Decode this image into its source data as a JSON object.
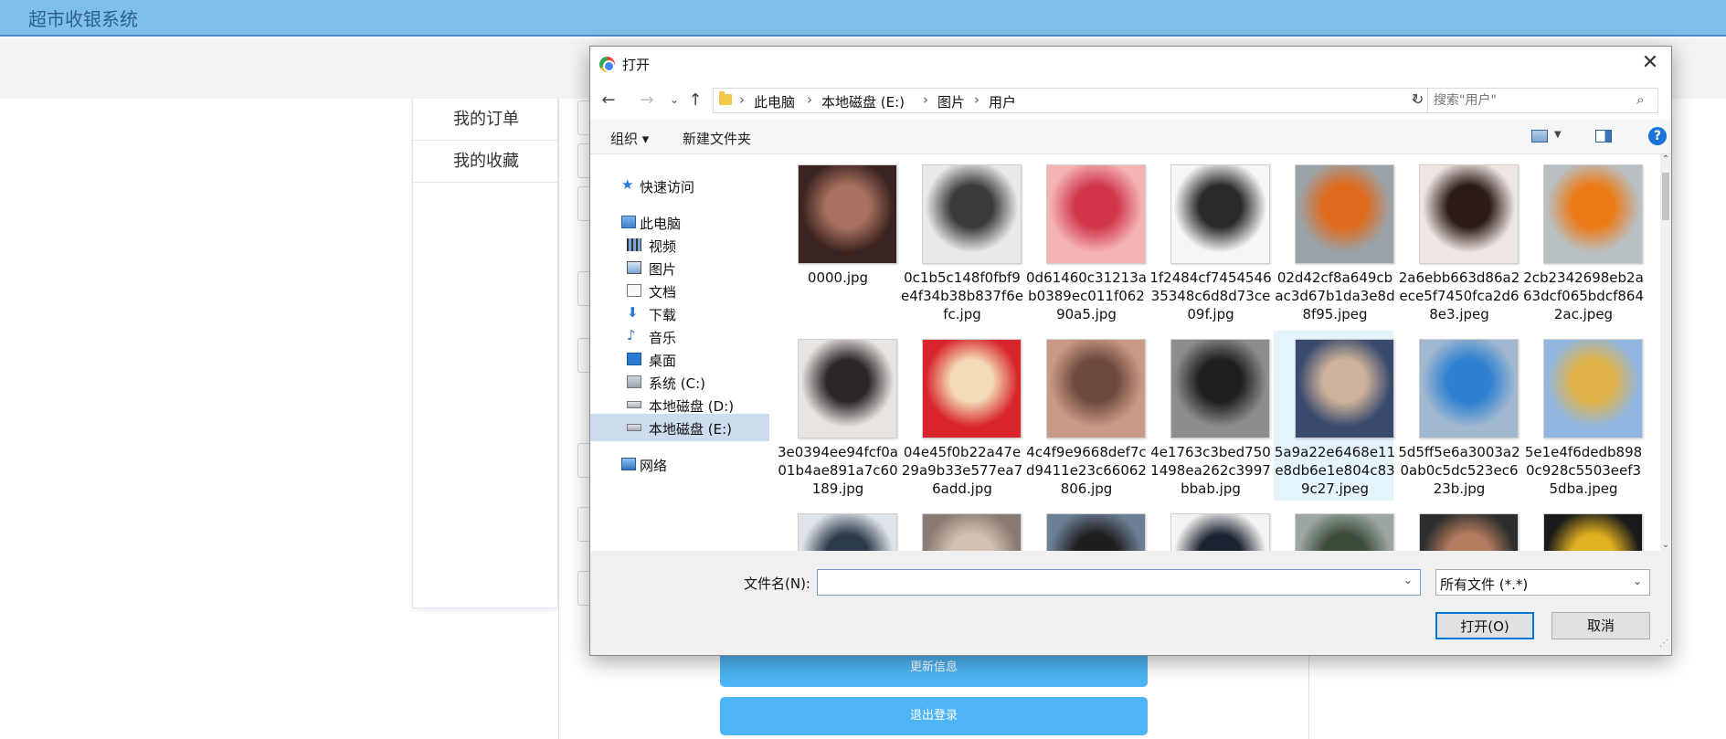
{
  "app": {
    "title": "超市收银系统"
  },
  "side_menu": {
    "items": [
      "我的订单",
      "我的收藏"
    ]
  },
  "page_buttons": {
    "update": "更新信息",
    "logout": "退出登录"
  },
  "dialog": {
    "title": "打开",
    "close_glyph": "✕",
    "breadcrumb": [
      "此电脑",
      "本地磁盘 (E:)",
      "图片",
      "用户"
    ],
    "search_placeholder": "搜索\"用户\"",
    "toolbar": {
      "organize": "组织 ▾",
      "new_folder": "新建文件夹",
      "help": "?"
    },
    "nav": [
      {
        "label": "快速访问",
        "icon": "star-icon"
      },
      {
        "label": "此电脑",
        "icon": "computer-icon"
      },
      {
        "label": "视频",
        "icon": "video-icon"
      },
      {
        "label": "图片",
        "icon": "pictures-icon"
      },
      {
        "label": "文档",
        "icon": "documents-icon"
      },
      {
        "label": "下载",
        "icon": "download-icon"
      },
      {
        "label": "音乐",
        "icon": "music-icon"
      },
      {
        "label": "桌面",
        "icon": "desktop-icon"
      },
      {
        "label": "系统 (C:)",
        "icon": "system-drive-icon"
      },
      {
        "label": "本地磁盘 (D:)",
        "icon": "drive-icon"
      },
      {
        "label": "本地磁盘 (E:)",
        "icon": "drive-icon",
        "selected": true
      },
      {
        "label": "网络",
        "icon": "network-icon"
      }
    ],
    "files": [
      {
        "name": "0000.jpg",
        "colors": [
          "#3a2320",
          "#a9715f"
        ]
      },
      {
        "name": "0c1b5c148f0fbf9e4f34b38b837f6efc.jpg",
        "colors": [
          "#e9e9e9",
          "#3b3b3b"
        ]
      },
      {
        "name": "0d61460c31213ab0389ec011f06290a5.jpg",
        "colors": [
          "#f4b3b3",
          "#d1364b"
        ]
      },
      {
        "name": "1f2484cf745454635348c6d8d73ce09f.jpg",
        "colors": [
          "#f6f6f6",
          "#2a2a2a"
        ]
      },
      {
        "name": "02d42cf8a649cbac3d67b1da3e8d8f95.jpeg",
        "colors": [
          "#9aa3a8",
          "#e06a1c"
        ]
      },
      {
        "name": "2a6ebb663d86a2ece5f7450fca2d68e3.jpeg",
        "colors": [
          "#efe6e3",
          "#2b1c18"
        ]
      },
      {
        "name": "2cb2342698eb2a63dcf065bdcf8642ac.jpeg",
        "colors": [
          "#b9c0c4",
          "#ec7a16"
        ]
      },
      {
        "name": "3e0394ee94fcf0a01b4ae891a7c60189.jpg",
        "colors": [
          "#e8e4e2",
          "#2c2626"
        ]
      },
      {
        "name": "04e45f0b22a47e29a9b33e577ea76add.jpg",
        "colors": [
          "#d8252a",
          "#f3d9b4"
        ]
      },
      {
        "name": "4c4f9e9668def7cd9411e23c66062806.jpg",
        "colors": [
          "#c99a86",
          "#6d4a3c"
        ]
      },
      {
        "name": "4e1763c3bed7501498ea262c3997bbab.jpg",
        "colors": [
          "#8d8d8d",
          "#1e1e1e"
        ]
      },
      {
        "name": "5a9a22e6468e11e8db6e1e804c839c27.jpeg",
        "colors": [
          "#3a4a6d",
          "#cfb39c"
        ],
        "selected": true
      },
      {
        "name": "5d5ff5e6a3003a20ab0c5dc523ec623b.jpg",
        "colors": [
          "#9fb7cf",
          "#2c7fd1"
        ]
      },
      {
        "name": "5e1e4f6dedb8980c928c5503eef35dba.jpeg",
        "colors": [
          "#8fb5e0",
          "#e0b44b"
        ]
      },
      {
        "name": "",
        "colors": [
          "#dfe4ea",
          "#2d3a4a"
        ]
      },
      {
        "name": "",
        "colors": [
          "#8a7b72",
          "#d2c2b6"
        ]
      },
      {
        "name": "",
        "colors": [
          "#6b7f95",
          "#1d1d1d"
        ]
      },
      {
        "name": "",
        "colors": [
          "#f3f3f3",
          "#1b2330"
        ]
      },
      {
        "name": "",
        "colors": [
          "#9ba7a0",
          "#3c4a3a"
        ]
      },
      {
        "name": "",
        "colors": [
          "#2d2d2d",
          "#b47c5e"
        ]
      },
      {
        "name": "",
        "colors": [
          "#1a1a1a",
          "#e0b020"
        ]
      }
    ],
    "filename_label": "文件名(N):",
    "filename_value": "",
    "filetype": "所有文件 (*.*)",
    "open_label": "打开(O)",
    "cancel_label": "取消"
  }
}
